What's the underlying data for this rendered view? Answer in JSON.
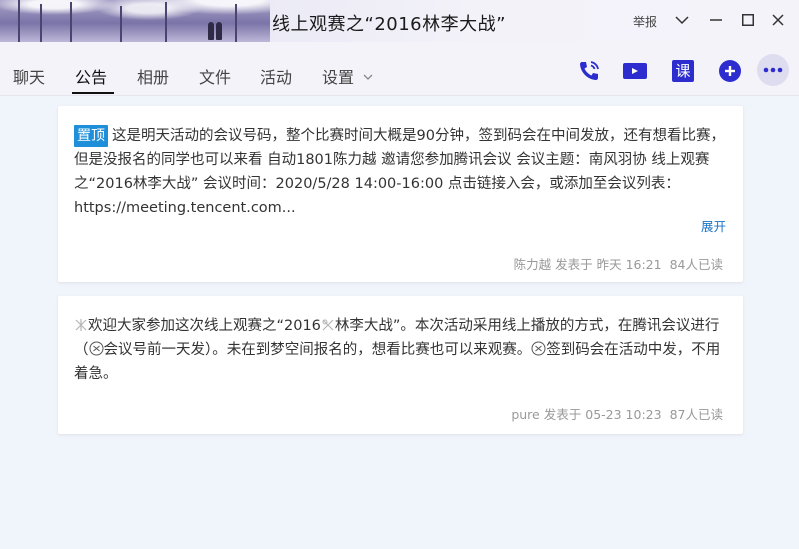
{
  "window": {
    "title": "线上观赛之“2016林李大战”",
    "report_label": "举报"
  },
  "tabs": [
    {
      "label": "聊天"
    },
    {
      "label": "公告",
      "active": true
    },
    {
      "label": "相册"
    },
    {
      "label": "文件"
    },
    {
      "label": "活动"
    },
    {
      "label": "设置"
    }
  ],
  "toolbar": {
    "course_label": "课",
    "accent_color": "#2d2dcf"
  },
  "announcements": [
    {
      "pinned_label": "置顶",
      "text": "这是明天活动的会议号码，整个比赛时间大概是90分钟，签到码会在中间发放，还有想看比赛，但是没报名的同学也可以来看 自动1801陈力越 邀请您参加腾讯会议 会议主题：南风羽协 线上观赛之“2016林李大战” 会议时间：2020/5/28 14:00-16:00 点击链接入会，或添加至会议列表：https://meeting.tencent.com...",
      "expand_label": "展开",
      "author": "陈力越",
      "posted_label": "发表于",
      "time": "昨天 16:21",
      "read_count": "84人已读"
    },
    {
      "text_a": "欢迎大家参加这次线上观赛之“2016",
      "text_b": "林李大战”。本次活动采用线上播放的方式，在腾讯会议进行（",
      "text_c": "会议号前一天发）。未在到梦空间报名的，想看比赛也可以来观赛。",
      "text_d": "签到码会在活动中发，不用着急。",
      "author": "pure",
      "posted_label": "发表于",
      "time": "05-23 10:23",
      "read_count": "87人已读"
    }
  ]
}
